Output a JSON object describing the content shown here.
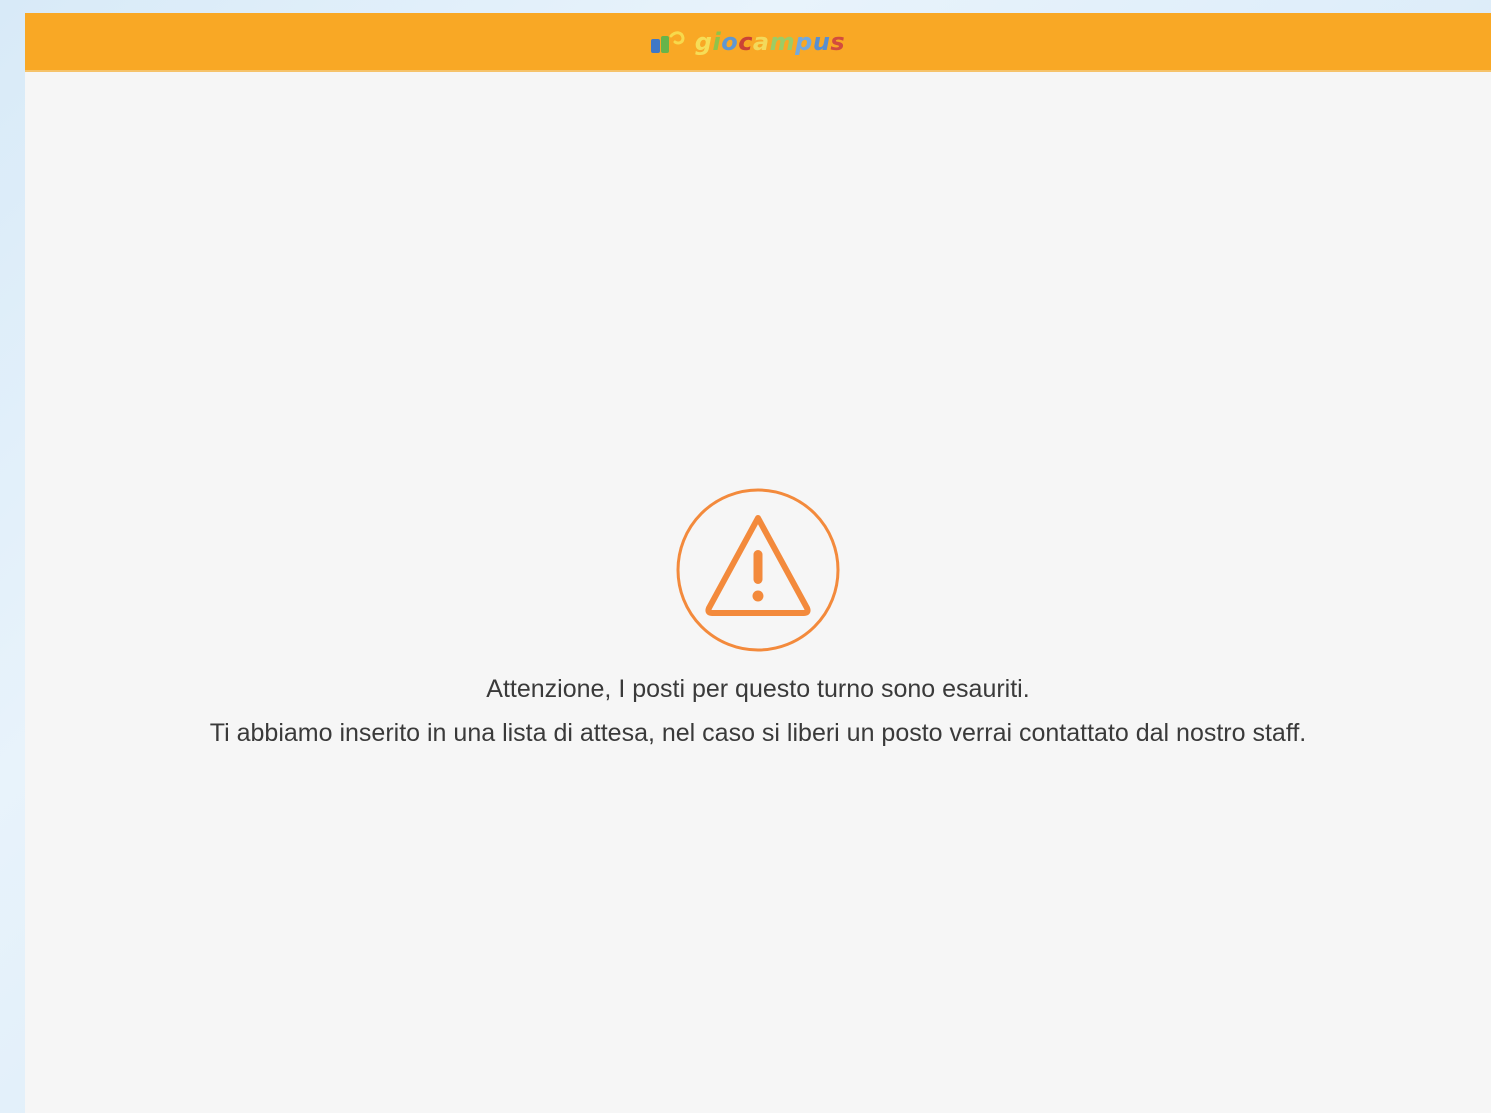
{
  "header": {
    "logo_text_parts": [
      "g",
      "i",
      "o",
      "c",
      "a",
      "m",
      "p",
      "u",
      "s"
    ],
    "logo_icon": "giocampus-logo-icon",
    "background_color": "#f9a825"
  },
  "alert": {
    "icon": "warning-icon",
    "icon_color": "#f38a3c",
    "line1": "Attenzione, I posti per questo turno sono esauriti.",
    "line2": "Ti abbiamo inserito in una lista di attesa, nel caso si liberi un posto verrai contattato dal nostro staff."
  }
}
